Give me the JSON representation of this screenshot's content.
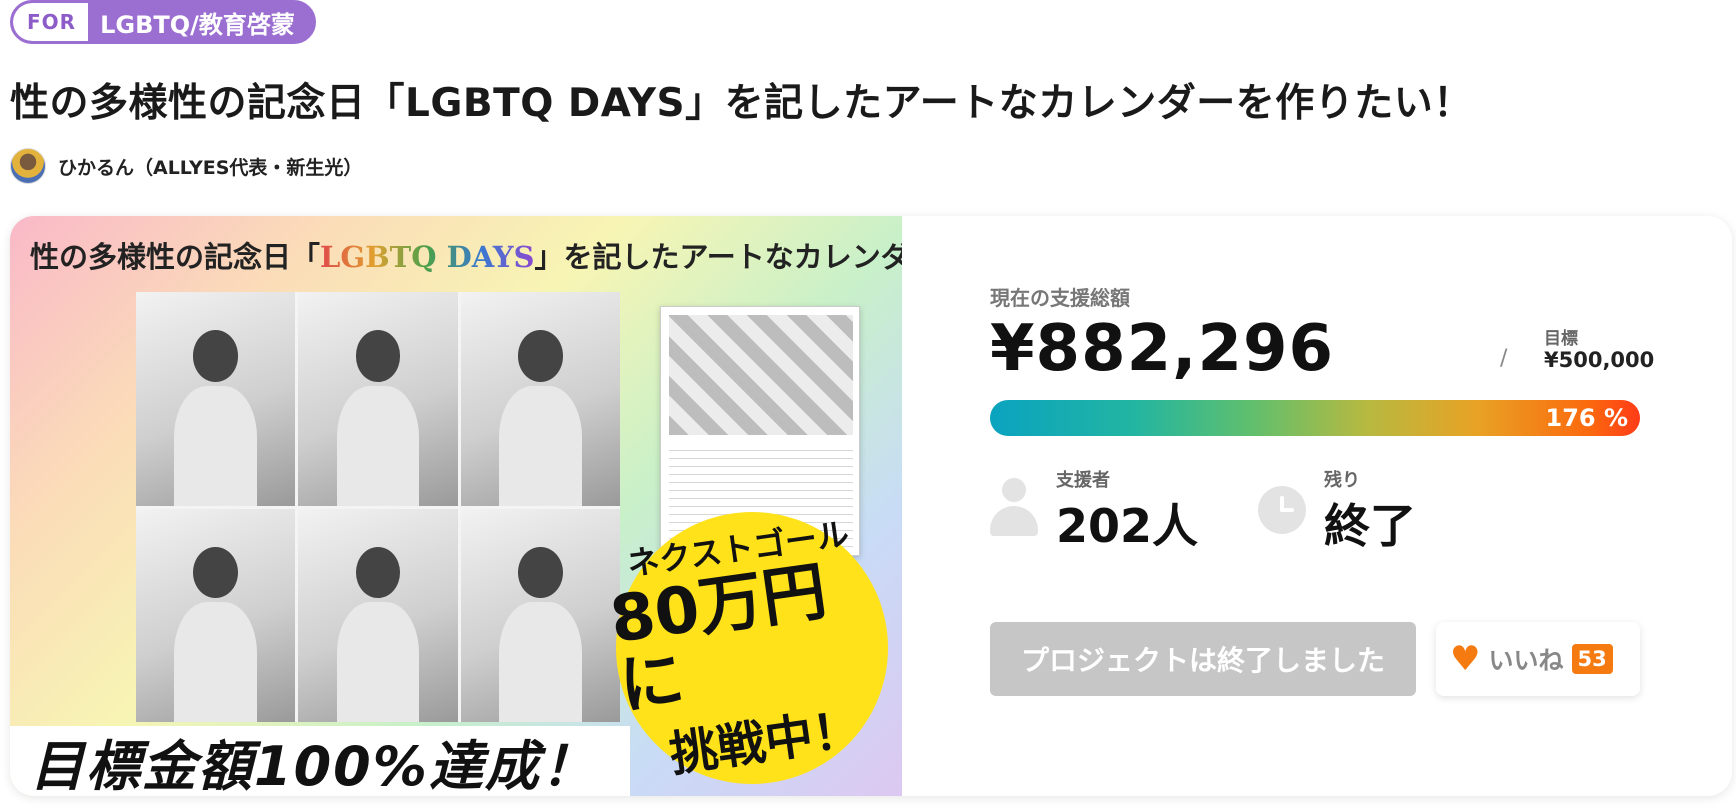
{
  "tag": {
    "for_label": "FOR",
    "category": "LGBTQ/教育啓蒙"
  },
  "project": {
    "title": "性の多様性の記念日「LGBTQ DAYS」を記したアートなカレンダーを作りたい！",
    "author": "ひかるん（ALLYES代表・新生光）"
  },
  "hero": {
    "title_pre": "性の多様性の記念日「",
    "title_highlight": "LGBTQ DAYS",
    "title_post": "」を記したアートなカレンダーを作りたい！",
    "next_goal_line1": "ネクストゴール",
    "next_goal_line2": "80万円に",
    "next_goal_line3": "挑戦中！",
    "banner": "目標金額100%達成！"
  },
  "funding": {
    "current_label": "現在の支援総額",
    "current_amount": "¥882,296",
    "slash": "/",
    "goal_label": "目標",
    "goal_amount": "¥500,000",
    "progress_text": "176 %",
    "progress_percent": 176,
    "supporters_label": "支援者",
    "supporters_value": "202人",
    "remaining_label": "残り",
    "remaining_value": "終了"
  },
  "actions": {
    "ended_label": "プロジェクトは終了しました",
    "like_label": "いいね",
    "like_count": "53"
  },
  "icons": {
    "like": "heart-icon",
    "supporters": "person-icon",
    "remaining": "clock-icon"
  },
  "colors": {
    "accent_purple": "#9b6fd1",
    "like_orange": "#f57a10",
    "ended_gray": "#c6c6c6"
  }
}
